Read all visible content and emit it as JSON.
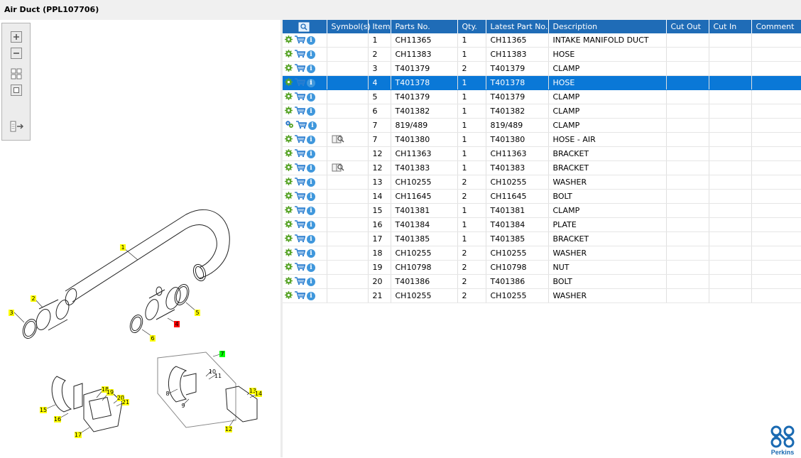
{
  "window": {
    "title": "Air Duct (PPL107706)"
  },
  "toolbar": {
    "zoom_in": "zoom-in-icon",
    "zoom_out": "zoom-out-icon",
    "fit": "fit-icon",
    "actual": "actual-size-icon",
    "toggle": "panel-toggle-icon"
  },
  "table": {
    "columns": [
      "",
      "Symbol(s)",
      "Item",
      "Parts No.",
      "Qty.",
      "Latest Part No.",
      "Description",
      "Cut Out",
      "Cut In",
      "Comment"
    ],
    "rows": [
      {
        "gear": "gear",
        "symbol": "",
        "item": "1",
        "part": "CH11365",
        "qty": "1",
        "latest": "CH11365",
        "desc": "INTAKE MANIFOLD DUCT",
        "cut_out": "",
        "cut_in": "",
        "comment": ""
      },
      {
        "gear": "gear",
        "symbol": "",
        "item": "2",
        "part": "CH11383",
        "qty": "1",
        "latest": "CH11383",
        "desc": "HOSE",
        "cut_out": "",
        "cut_in": "",
        "comment": ""
      },
      {
        "gear": "gear",
        "symbol": "",
        "item": "3",
        "part": "T401379",
        "qty": "2",
        "latest": "T401379",
        "desc": "CLAMP",
        "cut_out": "",
        "cut_in": "",
        "comment": ""
      },
      {
        "gear": "gear",
        "symbol": "",
        "item": "4",
        "part": "T401378",
        "qty": "1",
        "latest": "T401378",
        "desc": "HOSE",
        "cut_out": "",
        "cut_in": "",
        "comment": "",
        "selected": true
      },
      {
        "gear": "gear",
        "symbol": "",
        "item": "5",
        "part": "T401379",
        "qty": "1",
        "latest": "T401379",
        "desc": "CLAMP",
        "cut_out": "",
        "cut_in": "",
        "comment": ""
      },
      {
        "gear": "gear",
        "symbol": "",
        "item": "6",
        "part": "T401382",
        "qty": "1",
        "latest": "T401382",
        "desc": "CLAMP",
        "cut_out": "",
        "cut_in": "",
        "comment": ""
      },
      {
        "gear": "gears",
        "symbol": "",
        "item": "7",
        "part": "819/489",
        "qty": "1",
        "latest": "819/489",
        "desc": "CLAMP",
        "cut_out": "",
        "cut_in": "",
        "comment": ""
      },
      {
        "gear": "gear",
        "symbol": "book",
        "item": "7",
        "part": "T401380",
        "qty": "1",
        "latest": "T401380",
        "desc": "HOSE - AIR",
        "cut_out": "",
        "cut_in": "",
        "comment": ""
      },
      {
        "gear": "gear",
        "symbol": "",
        "item": "12",
        "part": "CH11363",
        "qty": "1",
        "latest": "CH11363",
        "desc": "BRACKET",
        "cut_out": "",
        "cut_in": "",
        "comment": ""
      },
      {
        "gear": "gear",
        "symbol": "book",
        "item": "12",
        "part": "T401383",
        "qty": "1",
        "latest": "T401383",
        "desc": "BRACKET",
        "cut_out": "",
        "cut_in": "",
        "comment": ""
      },
      {
        "gear": "gear",
        "symbol": "",
        "item": "13",
        "part": "CH10255",
        "qty": "2",
        "latest": "CH10255",
        "desc": "WASHER",
        "cut_out": "",
        "cut_in": "",
        "comment": ""
      },
      {
        "gear": "gear",
        "symbol": "",
        "item": "14",
        "part": "CH11645",
        "qty": "2",
        "latest": "CH11645",
        "desc": "BOLT",
        "cut_out": "",
        "cut_in": "",
        "comment": ""
      },
      {
        "gear": "gear",
        "symbol": "",
        "item": "15",
        "part": "T401381",
        "qty": "1",
        "latest": "T401381",
        "desc": "CLAMP",
        "cut_out": "",
        "cut_in": "",
        "comment": ""
      },
      {
        "gear": "gear",
        "symbol": "",
        "item": "16",
        "part": "T401384",
        "qty": "1",
        "latest": "T401384",
        "desc": "PLATE",
        "cut_out": "",
        "cut_in": "",
        "comment": ""
      },
      {
        "gear": "gear",
        "symbol": "",
        "item": "17",
        "part": "T401385",
        "qty": "1",
        "latest": "T401385",
        "desc": "BRACKET",
        "cut_out": "",
        "cut_in": "",
        "comment": ""
      },
      {
        "gear": "gear",
        "symbol": "",
        "item": "18",
        "part": "CH10255",
        "qty": "2",
        "latest": "CH10255",
        "desc": "WASHER",
        "cut_out": "",
        "cut_in": "",
        "comment": ""
      },
      {
        "gear": "gear",
        "symbol": "",
        "item": "19",
        "part": "CH10798",
        "qty": "2",
        "latest": "CH10798",
        "desc": "NUT",
        "cut_out": "",
        "cut_in": "",
        "comment": ""
      },
      {
        "gear": "gear",
        "symbol": "",
        "item": "20",
        "part": "T401386",
        "qty": "2",
        "latest": "T401386",
        "desc": "BOLT",
        "cut_out": "",
        "cut_in": "",
        "comment": ""
      },
      {
        "gear": "gear",
        "symbol": "",
        "item": "21",
        "part": "CH10255",
        "qty": "2",
        "latest": "CH10255",
        "desc": "WASHER",
        "cut_out": "",
        "cut_in": "",
        "comment": ""
      }
    ]
  },
  "diagram": {
    "callouts": [
      "1",
      "2",
      "3",
      "4",
      "5",
      "6",
      "7",
      "8",
      "9",
      "10",
      "11",
      "12",
      "13",
      "14",
      "15",
      "16",
      "17",
      "18",
      "19",
      "20",
      "21"
    ]
  },
  "brand": {
    "name": "Perkins",
    "color": "#1a6ab2"
  },
  "colors": {
    "header": "#1f6cb7",
    "selected": "#0a78d7",
    "callout_yellow": "#ffff00",
    "callout_red": "#ff0000",
    "callout_green": "#00ff00"
  }
}
